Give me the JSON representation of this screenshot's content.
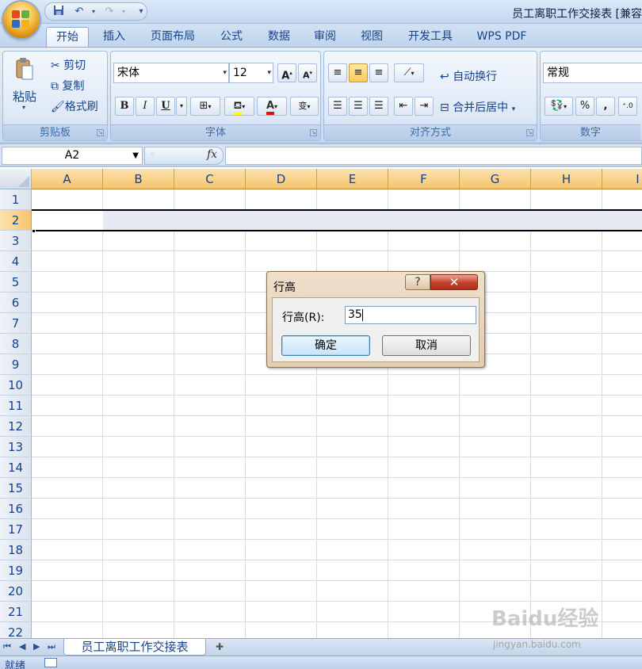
{
  "window": {
    "title": "员工离职工作交接表  [兼容"
  },
  "qat": {
    "save_icon": "save-icon",
    "undo_icon": "undo-icon",
    "redo_icon": "redo-icon"
  },
  "tabs": [
    {
      "label": "开始",
      "active": true
    },
    {
      "label": "插入"
    },
    {
      "label": "页面布局"
    },
    {
      "label": "公式"
    },
    {
      "label": "数据"
    },
    {
      "label": "审阅"
    },
    {
      "label": "视图"
    },
    {
      "label": "开发工具"
    },
    {
      "label": "WPS PDF"
    }
  ],
  "clipboard": {
    "paste": "粘贴",
    "cut": "剪切",
    "copy": "复制",
    "format_painter": "格式刷",
    "label": "剪贴板"
  },
  "font": {
    "name": "宋体",
    "size": "12",
    "bold": "B",
    "italic": "I",
    "underline": "U",
    "label": "字体",
    "wen": "wén",
    "wen_char": "变"
  },
  "align": {
    "wrap": "自动换行",
    "merge": "合并后居中",
    "label": "对齐方式"
  },
  "number": {
    "format": "常规",
    "percent": "%",
    "comma": ",",
    "label": "数字"
  },
  "formula_bar": {
    "name_box": "A2",
    "fx": "fx",
    "value": ""
  },
  "columns": [
    "A",
    "B",
    "C",
    "D",
    "E",
    "F",
    "G",
    "H",
    "I"
  ],
  "rows": [
    "1",
    "2",
    "3",
    "4",
    "5",
    "6",
    "7",
    "8",
    "9",
    "10",
    "11",
    "12",
    "13",
    "14",
    "15",
    "16",
    "17",
    "18",
    "19",
    "20",
    "21",
    "22"
  ],
  "selected_row": "2",
  "dialog": {
    "title": "行高",
    "help": "?",
    "close": "✕",
    "label": "行高(R):",
    "value": "35",
    "ok": "确定",
    "cancel": "取消"
  },
  "sheet_tabs": {
    "active": "员工离职工作交接表"
  },
  "status": {
    "ready": "就绪"
  },
  "watermark": {
    "brand": "Baidu经验",
    "url": "jingyan.baidu.com"
  },
  "colors": {
    "accent": "#f7c46c",
    "ribbon": "#d6e3f3",
    "close": "#c4412b"
  }
}
